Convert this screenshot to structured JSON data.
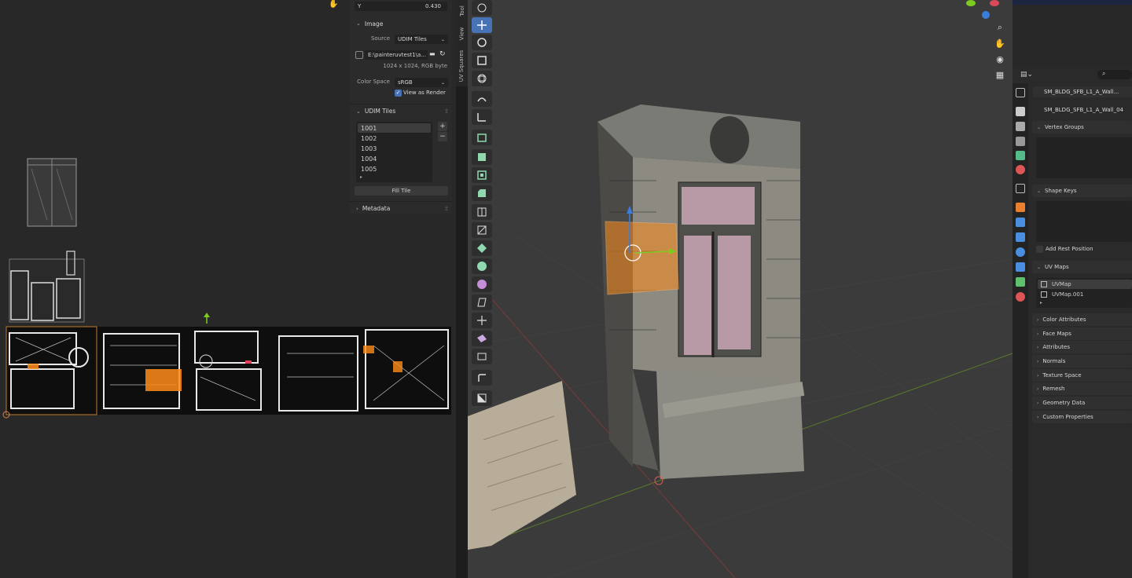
{
  "uv_sidebar": {
    "y_field": {
      "label": "Y",
      "value": "0.430"
    },
    "image_panel": {
      "title": "Image",
      "source_label": "Source",
      "source_value": "UDIM Tiles",
      "filepath": "E:\\painteruvtest1\\a...",
      "resolution": "1024 x 1024,  RGB byte",
      "colorspace_label": "Color Space",
      "colorspace_value": "sRGB",
      "view_as_render": "View as Render"
    },
    "udim_panel": {
      "title": "UDIM Tiles",
      "tiles": [
        "1001",
        "1002",
        "1003",
        "1004",
        "1005"
      ],
      "fill_tile": "Fill Tile"
    },
    "metadata_panel": {
      "title": "Metadata"
    }
  },
  "side_tabs": [
    "Tool",
    "View",
    "UV Squares"
  ],
  "properties": {
    "object_name": "SM_BLDG_SFB_L1_A_Wall...",
    "mesh_name": "SM_BLDG_SFB_L1_A_Wall_04",
    "vertex_groups": "Vertex Groups",
    "shape_keys": "Shape Keys",
    "add_rest_position": "Add Rest Position",
    "uv_maps": {
      "title": "UV Maps",
      "items": [
        "UVMap",
        "UVMap.001"
      ]
    },
    "sections": [
      "Color Attributes",
      "Face Maps",
      "Attributes",
      "Normals",
      "Texture Space",
      "Remesh",
      "Geometry Data",
      "Custom Properties"
    ]
  },
  "colors": {
    "active_tool": "#4772b3",
    "selection": "#ff8c1a",
    "udim_active": "#3d3d3d"
  }
}
